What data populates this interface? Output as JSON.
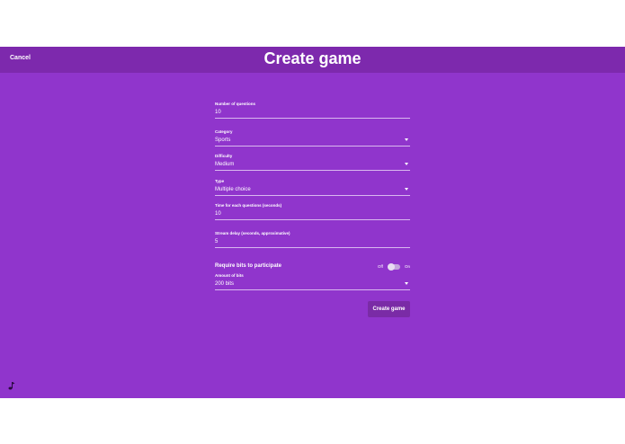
{
  "header": {
    "cancel_label": "Cancel",
    "title": "Create game"
  },
  "form": {
    "questions": {
      "label": "Number of questions",
      "value": "10"
    },
    "category": {
      "label": "Category",
      "value": "Sports"
    },
    "difficulty": {
      "label": "Difficulty",
      "value": "Medium"
    },
    "type": {
      "label": "Type",
      "value": "Multiple choice"
    },
    "time": {
      "label": "Time for each questions (seconds)",
      "value": "10"
    },
    "delay": {
      "label": "Stream delay (seconds, approximative)",
      "value": "5"
    },
    "require_bits": {
      "label": "Require bits to participate",
      "off_label": "Off",
      "on_label": "On",
      "enabled": false
    },
    "bits": {
      "label": "Amount of bits",
      "value": "200 bits"
    },
    "submit_label": "Create game"
  },
  "colors": {
    "background": "#9035cc",
    "header": "#7d29ad",
    "button": "#7a2ba6"
  },
  "icons": {
    "music": "music-note-icon"
  }
}
